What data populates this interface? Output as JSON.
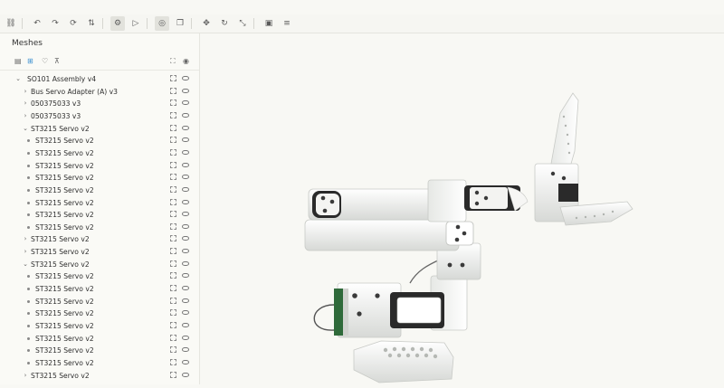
{
  "panel": {
    "title": "Meshes"
  },
  "icons": {
    "toolbar": [
      "link-icon",
      "undo-icon",
      "redo-icon",
      "refresh-icon",
      "sort-icon",
      "settings-icon",
      "play-icon",
      "target-icon",
      "copy-icon",
      "move-icon",
      "rotate-icon",
      "scale-icon",
      "camera-icon",
      "menu-icon"
    ],
    "panel_tools": [
      "list-icon",
      "tree-icon",
      "heart-icon",
      "collapse-icon",
      "fit-all-icon",
      "eye-icon"
    ]
  },
  "tree": {
    "rows": [
      {
        "label": "SO101 Assembly v4",
        "depth": 0,
        "kind": "open"
      },
      {
        "label": "Bus Servo Adapter (A) v3",
        "depth": 1,
        "kind": "closed"
      },
      {
        "label": "050375033 v3",
        "depth": 1,
        "kind": "closed"
      },
      {
        "label": "050375033 v3",
        "depth": 1,
        "kind": "closed"
      },
      {
        "label": "ST3215 Servo v2",
        "depth": 1,
        "kind": "open"
      },
      {
        "label": "ST3215 Servo v2",
        "depth": 2,
        "kind": "leaf"
      },
      {
        "label": "ST3215 Servo v2",
        "depth": 2,
        "kind": "leaf"
      },
      {
        "label": "ST3215 Servo v2",
        "depth": 2,
        "kind": "leaf"
      },
      {
        "label": "ST3215 Servo v2",
        "depth": 2,
        "kind": "leaf"
      },
      {
        "label": "ST3215 Servo v2",
        "depth": 2,
        "kind": "leaf"
      },
      {
        "label": "ST3215 Servo v2",
        "depth": 2,
        "kind": "leaf"
      },
      {
        "label": "ST3215 Servo v2",
        "depth": 2,
        "kind": "leaf"
      },
      {
        "label": "ST3215 Servo v2",
        "depth": 2,
        "kind": "leaf"
      },
      {
        "label": "ST3215 Servo v2",
        "depth": 1,
        "kind": "closed"
      },
      {
        "label": "ST3215 Servo v2",
        "depth": 1,
        "kind": "closed"
      },
      {
        "label": "ST3215 Servo v2",
        "depth": 1,
        "kind": "open"
      },
      {
        "label": "ST3215 Servo v2",
        "depth": 2,
        "kind": "leaf"
      },
      {
        "label": "ST3215 Servo v2",
        "depth": 2,
        "kind": "leaf"
      },
      {
        "label": "ST3215 Servo v2",
        "depth": 2,
        "kind": "leaf"
      },
      {
        "label": "ST3215 Servo v2",
        "depth": 2,
        "kind": "leaf"
      },
      {
        "label": "ST3215 Servo v2",
        "depth": 2,
        "kind": "leaf"
      },
      {
        "label": "ST3215 Servo v2",
        "depth": 2,
        "kind": "leaf"
      },
      {
        "label": "ST3215 Servo v2",
        "depth": 2,
        "kind": "leaf"
      },
      {
        "label": "ST3215 Servo v2",
        "depth": 2,
        "kind": "leaf"
      },
      {
        "label": "ST3215 Servo v2",
        "depth": 1,
        "kind": "closed"
      }
    ]
  }
}
